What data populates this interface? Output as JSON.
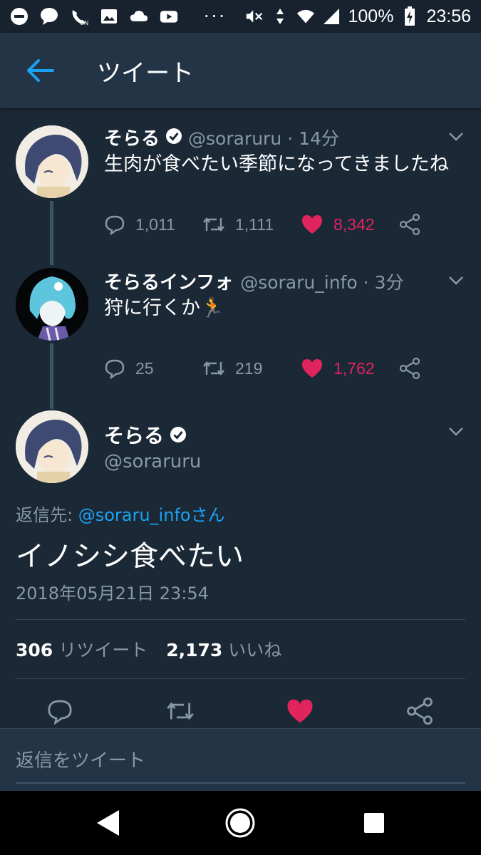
{
  "status_bar": {
    "battery": "100%",
    "time": "23:56",
    "icons": [
      "minus-circle-icon",
      "chat-bubble-icon",
      "wifi-calling-on-icon",
      "image-icon",
      "cloud-icon",
      "youtube-icon",
      "mute-icon",
      "data-arrows-icon",
      "wifi-icon",
      "signal-icon",
      "battery-charging-icon"
    ]
  },
  "app_bar": {
    "title": "ツイート"
  },
  "thread": [
    {
      "name": "そらる",
      "verified": true,
      "handle": "@soraruru",
      "time": "· 14分",
      "text": "生肉が食べたい季節になってきましたね",
      "replies": "1,011",
      "retweets": "1,111",
      "likes": "8,342",
      "liked": true
    },
    {
      "name": "そらるインフォ",
      "verified": false,
      "handle": "@soraru_info",
      "time": "· 3分",
      "text": "狩に行くか🏃",
      "replies": "25",
      "retweets": "219",
      "likes": "1,762",
      "liked": true
    }
  ],
  "main_tweet": {
    "name": "そらる",
    "verified": true,
    "handle": "@soraruru",
    "reply_prefix": "返信先: ",
    "reply_target": "@soraru_infoさん",
    "text": "イノシシ食べたい",
    "timestamp": "2018年05月21日 23:54",
    "retweet_count": "306",
    "retweet_label": "リツイート",
    "like_count": "2,173",
    "like_label": "いいね",
    "liked": true
  },
  "compose": {
    "placeholder": "返信をツイート"
  },
  "colors": {
    "background": "#1b2836",
    "header": "#243447",
    "accent": "#1da1f2",
    "like": "#e0245e",
    "secondary_text": "#8899a6"
  }
}
